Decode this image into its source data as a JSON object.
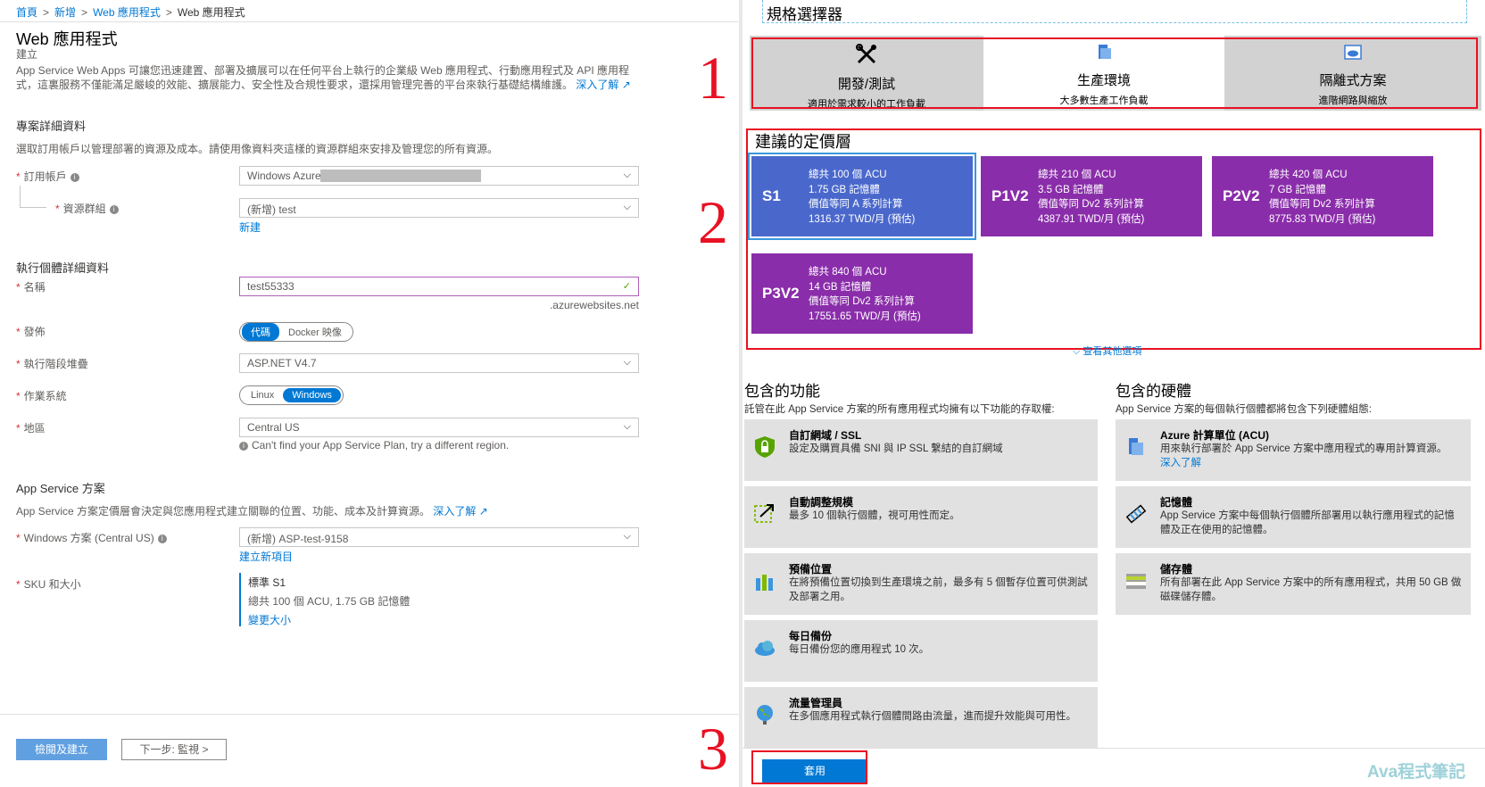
{
  "breadcrumb": {
    "items": [
      "首頁",
      "新增",
      "Web 應用程式",
      "Web 應用程式"
    ]
  },
  "page": {
    "title": "Web 應用程式",
    "subtitle": "建立"
  },
  "description": {
    "text": "App Service Web Apps 可讓您迅速建置、部署及擴展可以在任何平台上執行的企業級 Web 應用程式、行動應用程式及 API 應用程式，這裏服務不僅能滿足嚴峻的效能、擴展能力、安全性及合規性要求，還採用管理完善的平台來執行基礎結構維護。",
    "learn_more": "深入了解"
  },
  "project": {
    "heading": "專案詳細資料",
    "text": "選取訂用帳戶以管理部署的資源及成本。請使用像資料夾這樣的資源群組來安排及管理您的所有資源。",
    "subscription_label": "訂用帳戶",
    "subscription_value": "Windows Azure",
    "resource_group_label": "資源群組",
    "resource_group_value": "(新增) test",
    "new_link": "新建"
  },
  "instance": {
    "heading": "執行個體詳細資料",
    "name_label": "名稱",
    "name_value": "test55333",
    "name_suffix": ".azurewebsites.net",
    "publish_label": "發佈",
    "publish_options": [
      "代碼",
      "Docker 映像"
    ],
    "runtime_label": "執行階段堆疊",
    "runtime_value": "ASP.NET V4.7",
    "os_label": "作業系統",
    "os_options": [
      "Linux",
      "Windows"
    ],
    "region_label": "地區",
    "region_value": "Central US",
    "region_hint": "Can't find your App Service Plan, try a different region."
  },
  "plan": {
    "heading": "App Service 方案",
    "text": "App Service 方案定價層會決定與您應用程式建立關聯的位置、功能、成本及計算資源。",
    "learn_more": "深入了解",
    "windows_plan_label": "Windows 方案 (Central US)",
    "windows_plan_value": "(新增) ASP-test-9158",
    "create_new": "建立新項目",
    "sku_label": "SKU 和大小",
    "sku_title": "標準 S1",
    "sku_detail": "總共 100 個 ACU, 1.75 GB 記憶體",
    "sku_change": "變更大小"
  },
  "footer": {
    "review_button": "檢閱及建立",
    "next_button": "下一步: 監視 >"
  },
  "spec_picker": {
    "title": "規格選擇器",
    "tabs": [
      {
        "title": "開發/測試",
        "desc": "適用於需求較小的工作負載",
        "icon": "tools-icon"
      },
      {
        "title": "生產環境",
        "desc": "大多數生產工作負載",
        "icon": "server-icon"
      },
      {
        "title": "隔離式方案",
        "desc": "進階網路與縮放",
        "icon": "cloud-box-icon"
      }
    ],
    "recommended_heading": "建議的定價層",
    "tiers": [
      {
        "name": "S1",
        "lines": [
          "總共 100 個 ACU",
          "1.75 GB 記憶體",
          "價值等同 A 系列計算",
          "1316.37 TWD/月 (預估)"
        ]
      },
      {
        "name": "P1V2",
        "lines": [
          "總共 210 個 ACU",
          "3.5 GB 記憶體",
          "價值等同 Dv2 系列計算",
          "4387.91 TWD/月 (預估)"
        ]
      },
      {
        "name": "P2V2",
        "lines": [
          "總共 420 個 ACU",
          "7 GB 記憶體",
          "價值等同 Dv2 系列計算",
          "8775.83 TWD/月 (預估)"
        ]
      },
      {
        "name": "P3V2",
        "lines": [
          "總共 840 個 ACU",
          "14 GB 記憶體",
          "價值等同 Dv2 系列計算",
          "17551.65 TWD/月 (預估)"
        ]
      }
    ],
    "see_more": "查看其他選項",
    "features_heading": "包含的功能",
    "features_text": "託管在此 App Service 方案的所有應用程式均擁有以下功能的存取權:",
    "features": [
      {
        "title": "自訂網域 / SSL",
        "desc": "設定及購買具備 SNI 與 IP SSL 繫結的自訂網域"
      },
      {
        "title": "自動調整規模",
        "desc": "最多 10 個執行個體，視可用性而定。"
      },
      {
        "title": "預備位置",
        "desc": "在將預備位置切換到生產環境之前，最多有 5 個暫存位置可供測試及部署之用。"
      },
      {
        "title": "每日備份",
        "desc": "每日備份您的應用程式 10 次。"
      },
      {
        "title": "流量管理員",
        "desc": "在多個應用程式執行個體間路由流量，進而提升效能與可用性。"
      }
    ],
    "hardware_heading": "包含的硬體",
    "hardware_text": "App Service 方案的每個執行個體都將包含下列硬體組態:",
    "hardware": [
      {
        "title": "Azure 計算單位 (ACU)",
        "desc": "用來執行部署於 App Service 方案中應用程式的專用計算資源。",
        "link": "深入了解"
      },
      {
        "title": "記憶體",
        "desc": "App Service 方案中每個執行個體所部署用以執行應用程式的記憶體及正在使用的記憶體。"
      },
      {
        "title": "儲存體",
        "desc": "所有部署在此 App Service 方案中的所有應用程式，共用 50 GB 做磁碟儲存體。"
      }
    ],
    "apply_button": "套用"
  },
  "annotations": [
    "1",
    "2",
    "3"
  ],
  "watermark": "Ava程式筆記"
}
